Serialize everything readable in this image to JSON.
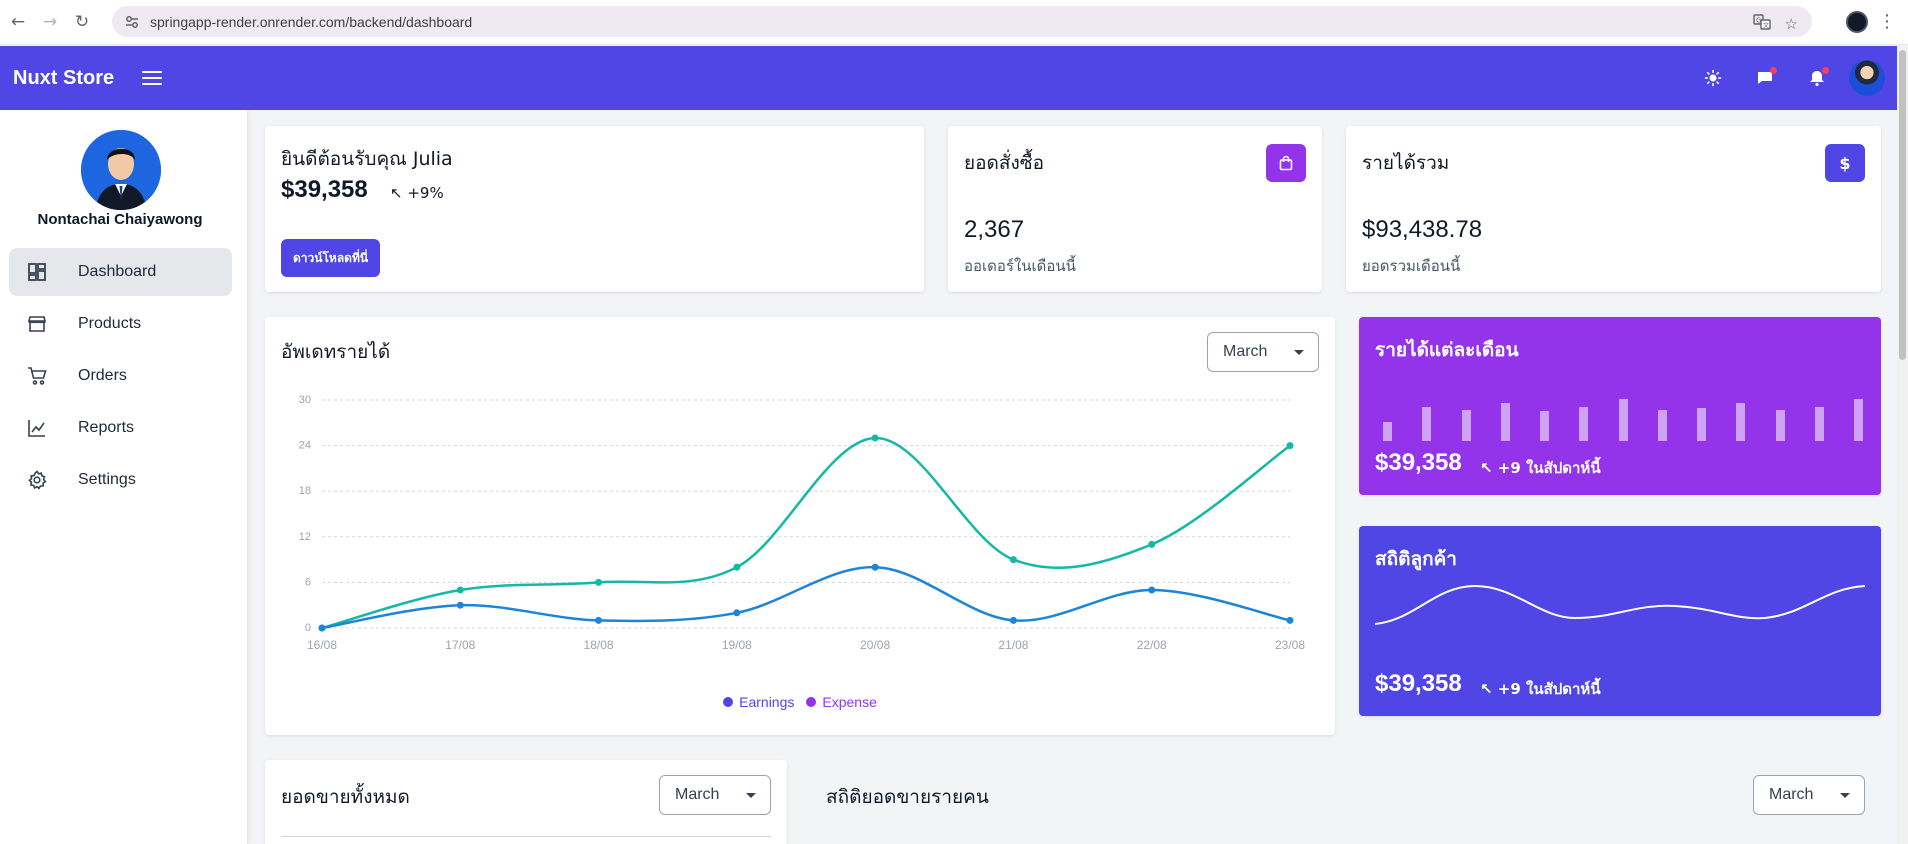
{
  "browser": {
    "url": "springapp-render.onrender.com/backend/dashboard"
  },
  "app": {
    "brand": "Nuxt Store"
  },
  "user": {
    "name": "Nontachai Chaiyawong"
  },
  "sidebar": {
    "items": [
      {
        "label": "Dashboard",
        "icon": "dashboard-icon",
        "active": true
      },
      {
        "label": "Products",
        "icon": "store-icon",
        "active": false
      },
      {
        "label": "Orders",
        "icon": "cart-icon",
        "active": false
      },
      {
        "label": "Reports",
        "icon": "chart-line-icon",
        "active": false
      },
      {
        "label": "Settings",
        "icon": "gear-icon",
        "active": false
      }
    ]
  },
  "welcome": {
    "greeting": "ยินดีต้อนรับคุณ Julia",
    "amount": "$39,358",
    "trend": "↖ +9%",
    "button_label": "ดาวน์โหลดที่นี่"
  },
  "orders": {
    "title": "ยอดสั่งซื้อ",
    "value": "2,367",
    "subtitle": "ออเดอร์ในเดือนนี้",
    "badge_color": "#9333ea",
    "icon": "shopping-bag-icon"
  },
  "revenue": {
    "title": "รายได้รวม",
    "value": "$93,438.78",
    "subtitle": "ยอดรวมเดือนนี้",
    "badge_symbol": "$",
    "badge_color": "#4f46e5",
    "icon": "dollar-icon"
  },
  "earnings_chart": {
    "title": "อัพเดทรายได้",
    "month": "March"
  },
  "monthly_revenue": {
    "title": "รายได้แต่ละเดือน",
    "amount": "$39,358",
    "trend": "↖ +9 ในสัปดาห์นี้",
    "bars": [
      0.3,
      0.55,
      0.5,
      0.62,
      0.48,
      0.55,
      0.68,
      0.5,
      0.53,
      0.62,
      0.5,
      0.55,
      0.68
    ]
  },
  "customer_stats": {
    "title": "สถิติลูกค้า",
    "amount": "$39,358",
    "trend": "↖ +9 ในสัปดาห์นี้"
  },
  "total_sales": {
    "title": "ยอดขายทั้งหมด",
    "month": "March"
  },
  "person_sales": {
    "title": "สถิติยอดขายรายคน",
    "month": "March"
  },
  "colors": {
    "primary": "#4f46e5",
    "purple": "#9333ea",
    "expense_line": "#14b8a6",
    "earnings_line": "#1d84d6"
  },
  "chart_data": {
    "type": "line",
    "x": [
      "16/08",
      "17/08",
      "18/08",
      "19/08",
      "20/08",
      "21/08",
      "22/08",
      "23/08"
    ],
    "yticks": [
      0,
      6,
      12,
      18,
      24,
      30
    ],
    "ylim": [
      0,
      30
    ],
    "grid": true,
    "legend_position": "bottom",
    "series": [
      {
        "name": "Earnings",
        "values": [
          0,
          3,
          1,
          2,
          8,
          1,
          5,
          1
        ],
        "line_color": "#1d84d6",
        "legend_color": "#4f46e5"
      },
      {
        "name": "Expense",
        "values": [
          0,
          5,
          6,
          8,
          25,
          9,
          11,
          24
        ],
        "line_color": "#14b8a6",
        "legend_color": "#9333ea"
      }
    ]
  }
}
